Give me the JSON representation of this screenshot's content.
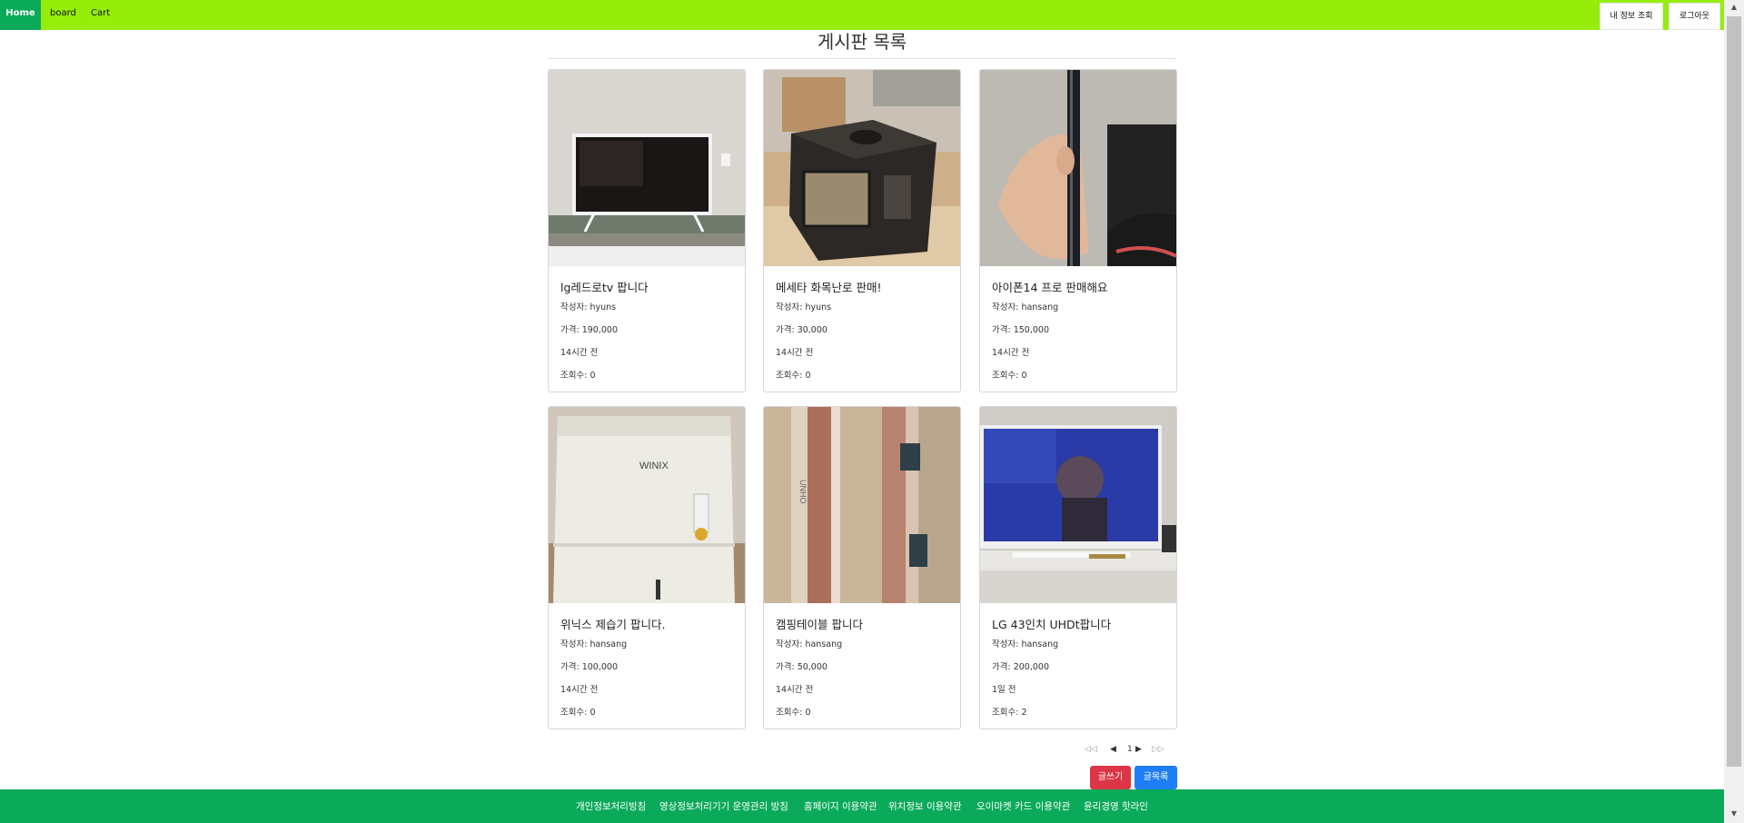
{
  "nav": {
    "home": "Home",
    "board": "board",
    "cart": "Cart",
    "my_info": "내 정보 조회",
    "logout": "로그아웃"
  },
  "page": {
    "title": "게시판 목록"
  },
  "labels": {
    "author_prefix": "작성자: ",
    "price_prefix": "가격: ",
    "views_prefix": "조회수: "
  },
  "posts": [
    {
      "title": "lg레드로tv 팝니다",
      "author": "작성자: hyuns",
      "price": "가격: 190,000",
      "time": "14시간 전",
      "views": "조회수: 0",
      "image": "tv-photo"
    },
    {
      "title": "메세타 화목난로 판매!",
      "author": "작성자: hyuns",
      "price": "가격: 30,000",
      "time": "14시간 전",
      "views": "조회수: 0",
      "image": "stove-photo"
    },
    {
      "title": "아이폰14 프로 판매해요",
      "author": "작성자: hansang",
      "price": "가격: 150,000",
      "time": "14시간 전",
      "views": "조회수: 0",
      "image": "phone-photo"
    },
    {
      "title": "위닉스 제습기 팝니다.",
      "author": "작성자: hansang",
      "price": "가격: 100,000",
      "time": "14시간 전",
      "views": "조회수: 0",
      "image": "dehumidifier-photo"
    },
    {
      "title": "캠핑테이블 팝니다",
      "author": "작성자: hansang",
      "price": "가격: 50,000",
      "time": "14시간 전",
      "views": "조회수: 0",
      "image": "table-photo"
    },
    {
      "title": "LG 43인치 UHDt팝니다",
      "author": "작성자: hansang",
      "price": "가격: 200,000",
      "time": "1일 전",
      "views": "조회수: 2",
      "image": "tv2-photo"
    }
  ],
  "pagination": {
    "first": "◁◁",
    "prev": "◀",
    "current": "1",
    "next": "▶",
    "last": "▷▷"
  },
  "actions": {
    "write": "글쓰기",
    "list": "글목록"
  },
  "footer": {
    "links": [
      "개인정보처리방침",
      "영상정보처리기기 운영관리 방침",
      "홈페이지 이용약관",
      "위치정보 이용약관",
      "오이마켓 카드 이용약관",
      "윤리경영 핫라인"
    ]
  },
  "colors": {
    "nav_bg": "#96ed0a",
    "home_bg": "#0aaa5a",
    "footer_bg": "#0aaa5a",
    "write_btn": "#dc3545",
    "list_btn": "#1e7ef5"
  }
}
